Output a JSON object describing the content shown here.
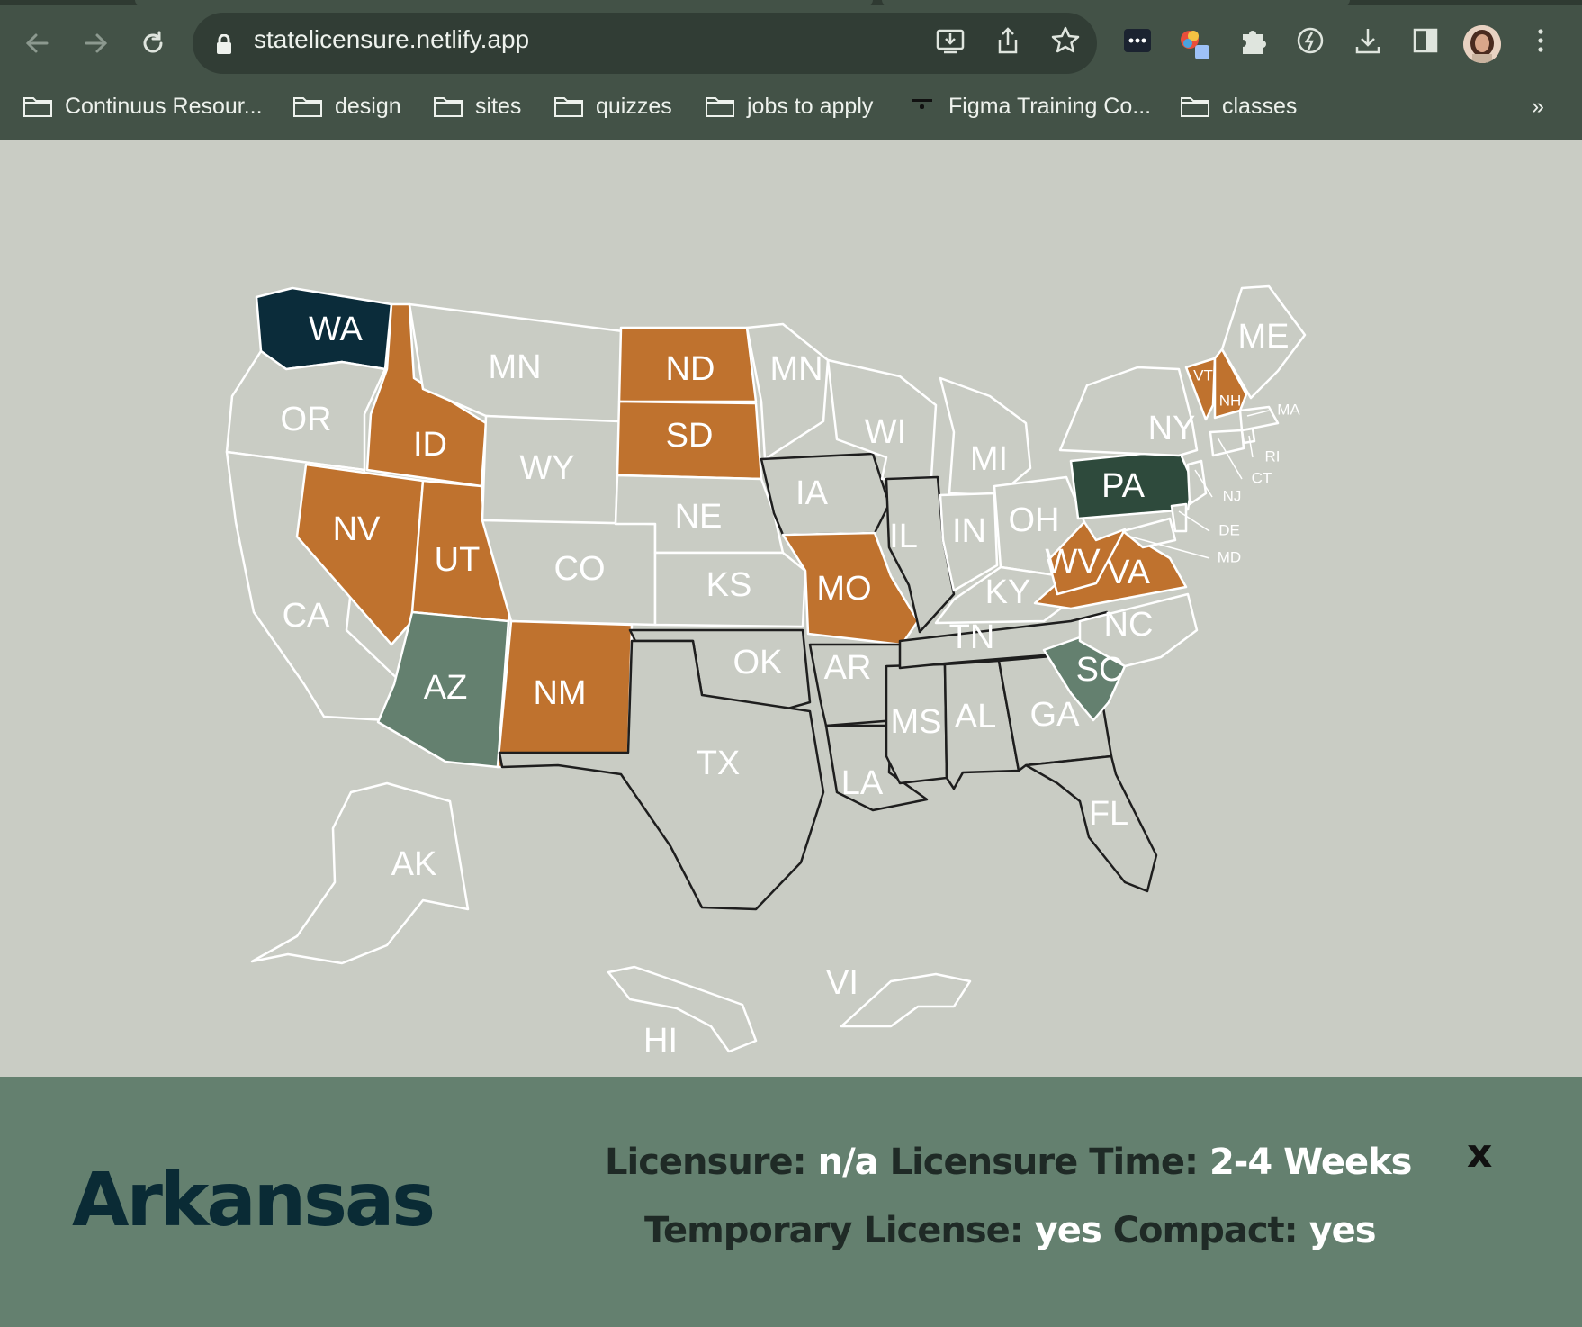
{
  "browser": {
    "url": "statelicensure.netlify.app",
    "bookmarks": [
      {
        "label": "Continuus Resour...",
        "icon": "folder-icon"
      },
      {
        "label": "design",
        "icon": "folder-icon"
      },
      {
        "label": "sites",
        "icon": "folder-icon"
      },
      {
        "label": "quizzes",
        "icon": "folder-icon"
      },
      {
        "label": "jobs to apply",
        "icon": "folder-icon"
      },
      {
        "label": "Figma Training Co...",
        "icon": "figma-icon"
      },
      {
        "label": "classes",
        "icon": "folder-icon"
      }
    ],
    "more_bookmarks": "»"
  },
  "map": {
    "colors": {
      "default": "#c9ccc4",
      "orange": "#bf722e",
      "navy": "#0b2c3a",
      "darkgreen": "#2e4a3c",
      "sage": "#64806f"
    },
    "states": [
      {
        "abbr": "WA",
        "color": "navy"
      },
      {
        "abbr": "OR",
        "color": "default"
      },
      {
        "abbr": "CA",
        "color": "default"
      },
      {
        "abbr": "ID",
        "color": "orange"
      },
      {
        "abbr": "NV",
        "color": "orange"
      },
      {
        "abbr": "UT",
        "color": "orange"
      },
      {
        "abbr": "AZ",
        "color": "sage"
      },
      {
        "abbr": "MN",
        "color": "default"
      },
      {
        "abbr": "WY",
        "color": "default"
      },
      {
        "abbr": "CO",
        "color": "default"
      },
      {
        "abbr": "NM",
        "color": "orange"
      },
      {
        "abbr": "ND",
        "color": "orange"
      },
      {
        "abbr": "SD",
        "color": "orange"
      },
      {
        "abbr": "NE",
        "color": "default"
      },
      {
        "abbr": "KS",
        "color": "default"
      },
      {
        "abbr": "OK",
        "color": "default"
      },
      {
        "abbr": "TX",
        "color": "default"
      },
      {
        "abbr": "MN",
        "color": "default"
      },
      {
        "abbr": "IA",
        "color": "default"
      },
      {
        "abbr": "MO",
        "color": "orange"
      },
      {
        "abbr": "AR",
        "color": "default"
      },
      {
        "abbr": "LA",
        "color": "default"
      },
      {
        "abbr": "WI",
        "color": "default"
      },
      {
        "abbr": "IL",
        "color": "default"
      },
      {
        "abbr": "MS",
        "color": "default"
      },
      {
        "abbr": "MI",
        "color": "default"
      },
      {
        "abbr": "IN",
        "color": "default"
      },
      {
        "abbr": "OH",
        "color": "default"
      },
      {
        "abbr": "KY",
        "color": "default"
      },
      {
        "abbr": "TN",
        "color": "default"
      },
      {
        "abbr": "AL",
        "color": "default"
      },
      {
        "abbr": "GA",
        "color": "default"
      },
      {
        "abbr": "FL",
        "color": "default"
      },
      {
        "abbr": "SC",
        "color": "sage"
      },
      {
        "abbr": "NC",
        "color": "default"
      },
      {
        "abbr": "VA",
        "color": "orange"
      },
      {
        "abbr": "WV",
        "color": "orange"
      },
      {
        "abbr": "PA",
        "color": "darkgreen"
      },
      {
        "abbr": "NY",
        "color": "default"
      },
      {
        "abbr": "VT",
        "color": "orange"
      },
      {
        "abbr": "NH",
        "color": "orange"
      },
      {
        "abbr": "ME",
        "color": "default"
      },
      {
        "abbr": "MA",
        "color": "default"
      },
      {
        "abbr": "RI",
        "color": "default"
      },
      {
        "abbr": "CT",
        "color": "default"
      },
      {
        "abbr": "NJ",
        "color": "default"
      },
      {
        "abbr": "DE",
        "color": "default"
      },
      {
        "abbr": "MD",
        "color": "default"
      },
      {
        "abbr": "AK",
        "color": "default"
      },
      {
        "abbr": "HI",
        "color": "default"
      },
      {
        "abbr": "VI",
        "color": "default"
      }
    ]
  },
  "panel": {
    "state_name": "Arkansas",
    "licensure_label": "Licensure:",
    "licensure_value": "n/a",
    "licensure_time_label": "Licensure Time:",
    "licensure_time_value": "2-4 Weeks",
    "temporary_label": "Temporary License:",
    "temporary_value": "yes",
    "compact_label": "Compact:",
    "compact_value": "yes",
    "close_label": "x"
  }
}
